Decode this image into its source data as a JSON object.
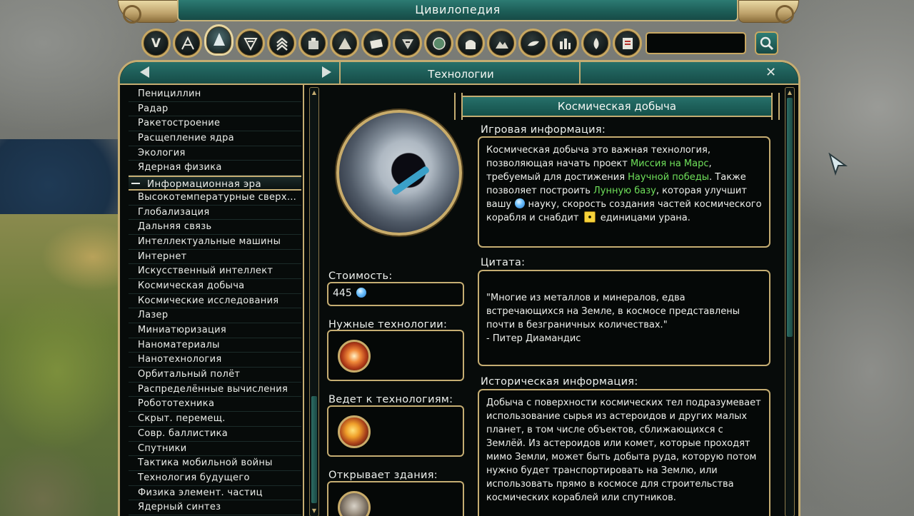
{
  "window": {
    "title": "Цивилопедия"
  },
  "search": {
    "placeholder": ""
  },
  "categories": [
    {
      "name": "V",
      "icon": "home-icon"
    },
    {
      "name": "",
      "icon": "compass-icon"
    },
    {
      "name": "",
      "icon": "technology-icon"
    },
    {
      "name": "",
      "icon": "unit-icon"
    },
    {
      "name": "",
      "icon": "promotion-icon"
    },
    {
      "name": "",
      "icon": "building-icon"
    },
    {
      "name": "",
      "icon": "wonder-icon"
    },
    {
      "name": "",
      "icon": "policy-icon"
    },
    {
      "name": "",
      "icon": "great-people-icon"
    },
    {
      "name": "",
      "icon": "civilization-icon"
    },
    {
      "name": "",
      "icon": "city-state-icon"
    },
    {
      "name": "",
      "icon": "terrain-icon"
    },
    {
      "name": "",
      "icon": "resource-icon"
    },
    {
      "name": "",
      "icon": "improvement-icon"
    },
    {
      "name": "",
      "icon": "religion-icon"
    },
    {
      "name": "",
      "icon": "world-congress-icon"
    }
  ],
  "header": {
    "title": "Технологии"
  },
  "tech_list": {
    "items_before": [
      "Пенициллин",
      "Радар",
      "Ракетостроение",
      "Расщепление ядра",
      "Экология",
      "Ядерная физика"
    ],
    "era_label": "Информационная эра",
    "items_after": [
      "Высокотемпературные сверхп...",
      "Глобализация",
      "Дальняя связь",
      "Интеллектуальные машины",
      "Интернет",
      "Искусственный интеллект",
      "Космическая добыча",
      "Космические исследования",
      "Лазер",
      "Миниатюризация",
      "Наноматериалы",
      "Нанотехнология",
      "Орбитальный полёт",
      "Распределённые вычисления",
      "Робототехника",
      "Скрыт. перемещ.",
      "Совр. баллистика",
      "Спутники",
      "Тактика мобильной войны",
      "Технология будущего",
      "Физика элемент. частиц",
      "Ядерный синтез"
    ]
  },
  "center": {
    "cost_label": "Стоимость:",
    "cost_value": "445",
    "required_label": "Нужные технологии:",
    "leads_to_label": "Ведет к технологиям:",
    "unlocks_label": "Открывает здания:"
  },
  "tech": {
    "name": "Космическая добыча",
    "game_info_label": "Игровая информация:",
    "game_info": {
      "p1": "Космическая добыча это важная технология, позволяющая начать проект ",
      "link1": "Миссия на Марс",
      "p2": ", требуемый для достижения ",
      "link2": "Научной победы",
      "p3": ". Также позволяет построить ",
      "link3": "Лунную базу",
      "p4": ", которая улучшит вашу ",
      "p5": " науку, скорость создания частей космического корабля и снабдит ",
      "p6": " единицами урана."
    },
    "quote_label": "Цитата:",
    "quote_text": "\"Многие из металлов и минералов, едва встречающихся на Земле, в космосе представлены почти в безграничных количествах.\"",
    "quote_author": " - Питер Диамандис",
    "history_label": "Историческая информация:",
    "history_text": "Добыча с поверхности космических тел подразумевает использование сырья из астероидов и других малых планет, в том числе объектов, сближающихся с Землёй. Из астероидов или комет, которые проходят мимо Земли, может быть добыта руда, которую потом нужно будет транспортировать на Землю, или использовать прямо в космосе для строительства космических кораблей или спутников."
  }
}
